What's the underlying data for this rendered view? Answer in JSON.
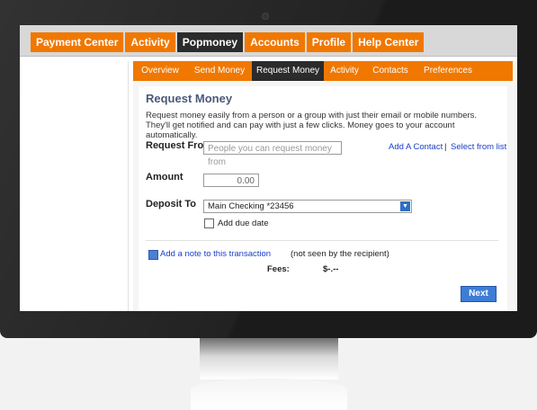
{
  "top_nav": {
    "items": [
      "Payment Center",
      "Activity",
      "Popmoney",
      "Accounts",
      "Profile",
      "Help Center"
    ],
    "active": "Popmoney"
  },
  "sub_nav": {
    "items": [
      "Overview",
      "Send Money",
      "Request Money",
      "Activity",
      "Contacts",
      "Preferences"
    ],
    "active": "Request Money"
  },
  "panel": {
    "title": "Request Money",
    "description": "Request money easily from a person or a group with just their email or mobile numbers. They'll get notified and can pay with just a few clicks. Money goes to your account automatically.",
    "request_from": {
      "label": "Request From",
      "placeholder": "People you can request money from",
      "add_contact": "Add A Contact",
      "separator": "|",
      "select_from_list": "Select from list"
    },
    "amount": {
      "label": "Amount",
      "value": "0.00"
    },
    "deposit_to": {
      "label": "Deposit To",
      "selected": "Main Checking *23456"
    },
    "due_date": {
      "label": "Add due date"
    },
    "note": {
      "link": "Add a note to this transaction",
      "suffix": "(not seen by the recipient)"
    },
    "fees": {
      "label": "Fees:",
      "value": "$-.--"
    },
    "next_button": "Next"
  },
  "colors": {
    "accent_orange": "#f07800",
    "active_dark": "#2b2b2b",
    "button_blue": "#3d7dd6",
    "title_blue": "#4a5a7a",
    "link_blue": "#1a3ec8"
  }
}
